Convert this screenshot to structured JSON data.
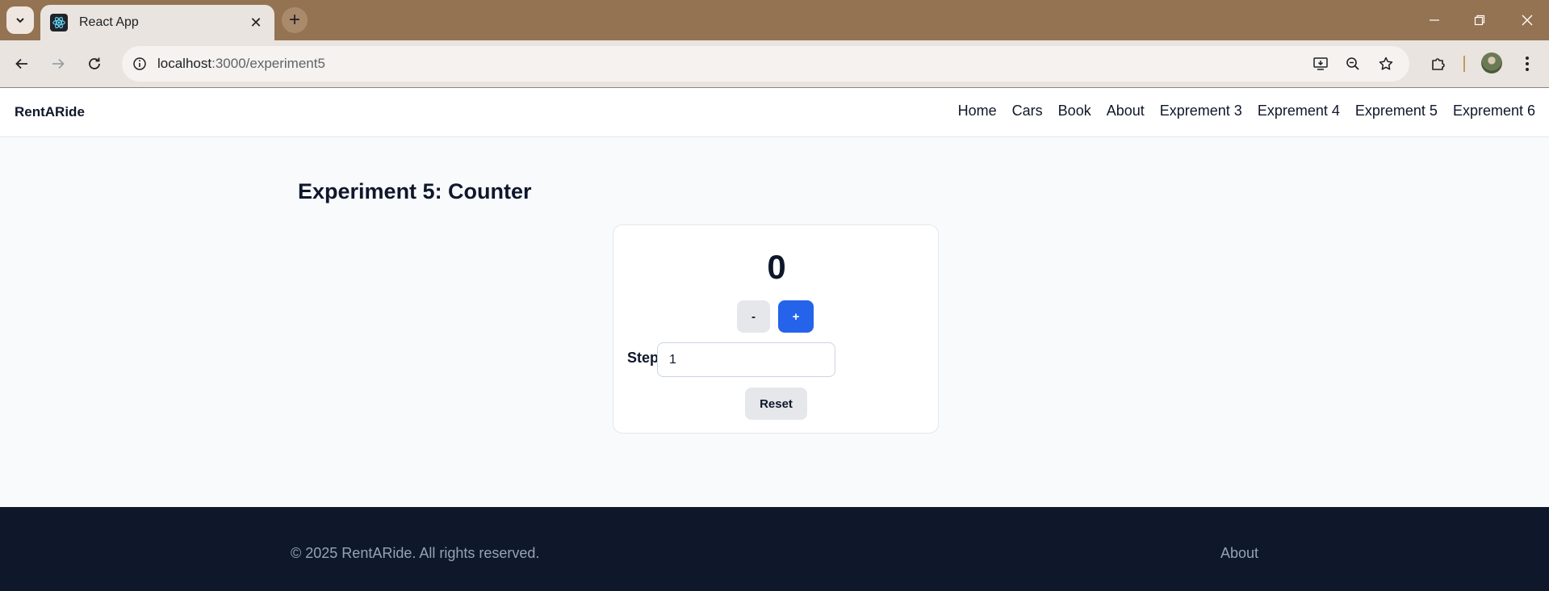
{
  "browser": {
    "tab_title": "React App",
    "url_host": "localhost",
    "url_path": ":3000/experiment5",
    "accent": "#947352"
  },
  "header": {
    "brand": "RentARide",
    "nav": [
      "Home",
      "Cars",
      "Book",
      "About",
      "Exprement 3",
      "Exprement 4",
      "Exprement 5",
      "Exprement 6"
    ]
  },
  "main": {
    "title": "Experiment 5: Counter",
    "counter_value": "0",
    "decrement_label": "-",
    "increment_label": "+",
    "step_label": "Step",
    "step_value": "1",
    "reset_label": "Reset",
    "primary_color": "#2563eb"
  },
  "footer": {
    "copyright": "© 2025 RentARide. All rights reserved.",
    "link": "About",
    "background": "#0f172a"
  }
}
